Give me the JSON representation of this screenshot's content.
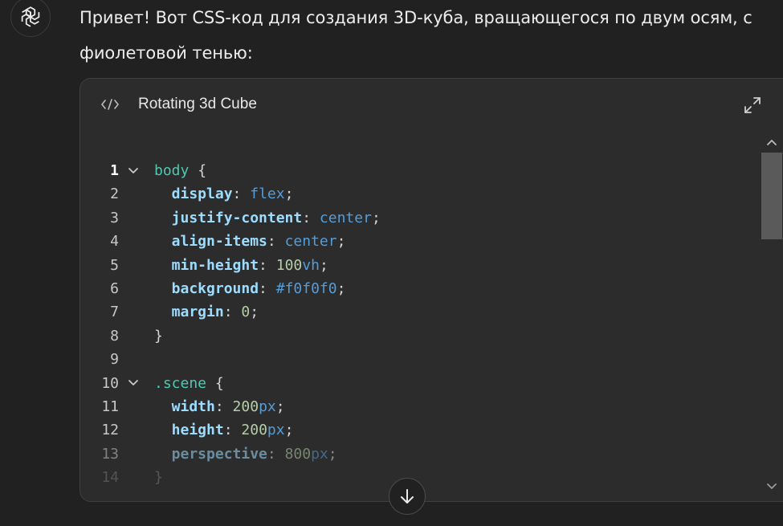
{
  "message": {
    "line1": "Привет! Вот CSS-код для создания 3D-куба, вращающегося по двум осям, с",
    "line2": "фиолетовой тенью:"
  },
  "code_card": {
    "title": "Rotating 3d Cube",
    "icon": "code-icon",
    "expand_icon": "expand-icon",
    "lines": [
      {
        "n": "1",
        "active": true,
        "fold": true,
        "tokens": [
          {
            "t": "body",
            "c": "sel"
          },
          {
            "t": " {",
            "c": "pun"
          }
        ]
      },
      {
        "n": "2",
        "tokens": [
          {
            "t": "  display",
            "c": "prop"
          },
          {
            "t": ": ",
            "c": "pun"
          },
          {
            "t": "flex",
            "c": "val"
          },
          {
            "t": ";",
            "c": "pun"
          }
        ]
      },
      {
        "n": "3",
        "tokens": [
          {
            "t": "  justify-content",
            "c": "prop"
          },
          {
            "t": ": ",
            "c": "pun"
          },
          {
            "t": "center",
            "c": "val"
          },
          {
            "t": ";",
            "c": "pun"
          }
        ]
      },
      {
        "n": "4",
        "tokens": [
          {
            "t": "  align-items",
            "c": "prop"
          },
          {
            "t": ": ",
            "c": "pun"
          },
          {
            "t": "center",
            "c": "val"
          },
          {
            "t": ";",
            "c": "pun"
          }
        ]
      },
      {
        "n": "5",
        "tokens": [
          {
            "t": "  min-height",
            "c": "prop"
          },
          {
            "t": ": ",
            "c": "pun"
          },
          {
            "t": "100",
            "c": "num"
          },
          {
            "t": "vh",
            "c": "unit"
          },
          {
            "t": ";",
            "c": "pun"
          }
        ]
      },
      {
        "n": "6",
        "tokens": [
          {
            "t": "  background",
            "c": "prop"
          },
          {
            "t": ": ",
            "c": "pun"
          },
          {
            "t": "#f0f0f0",
            "c": "val"
          },
          {
            "t": ";",
            "c": "pun"
          }
        ]
      },
      {
        "n": "7",
        "tokens": [
          {
            "t": "  margin",
            "c": "prop"
          },
          {
            "t": ": ",
            "c": "pun"
          },
          {
            "t": "0",
            "c": "num"
          },
          {
            "t": ";",
            "c": "pun"
          }
        ]
      },
      {
        "n": "8",
        "tokens": [
          {
            "t": "}",
            "c": "pun"
          }
        ]
      },
      {
        "n": "9",
        "tokens": []
      },
      {
        "n": "10",
        "fold": true,
        "tokens": [
          {
            "t": ".scene",
            "c": "sel"
          },
          {
            "t": " {",
            "c": "pun"
          }
        ]
      },
      {
        "n": "11",
        "tokens": [
          {
            "t": "  width",
            "c": "prop"
          },
          {
            "t": ": ",
            "c": "pun"
          },
          {
            "t": "200",
            "c": "num"
          },
          {
            "t": "px",
            "c": "unit"
          },
          {
            "t": ";",
            "c": "pun"
          }
        ]
      },
      {
        "n": "12",
        "tokens": [
          {
            "t": "  height",
            "c": "prop"
          },
          {
            "t": ": ",
            "c": "pun"
          },
          {
            "t": "200",
            "c": "num"
          },
          {
            "t": "px",
            "c": "unit"
          },
          {
            "t": ";",
            "c": "pun"
          }
        ]
      },
      {
        "n": "13",
        "fade": "fade13",
        "tokens": [
          {
            "t": "  perspective",
            "c": "prop"
          },
          {
            "t": ": ",
            "c": "pun"
          },
          {
            "t": "800",
            "c": "num"
          },
          {
            "t": "px",
            "c": "unit"
          },
          {
            "t": ";",
            "c": "pun"
          }
        ]
      },
      {
        "n": "14",
        "fade": "fade14",
        "tokens": [
          {
            "t": "}",
            "c": "pun"
          }
        ]
      }
    ]
  },
  "scroll_button_icon": "arrow-down-icon"
}
